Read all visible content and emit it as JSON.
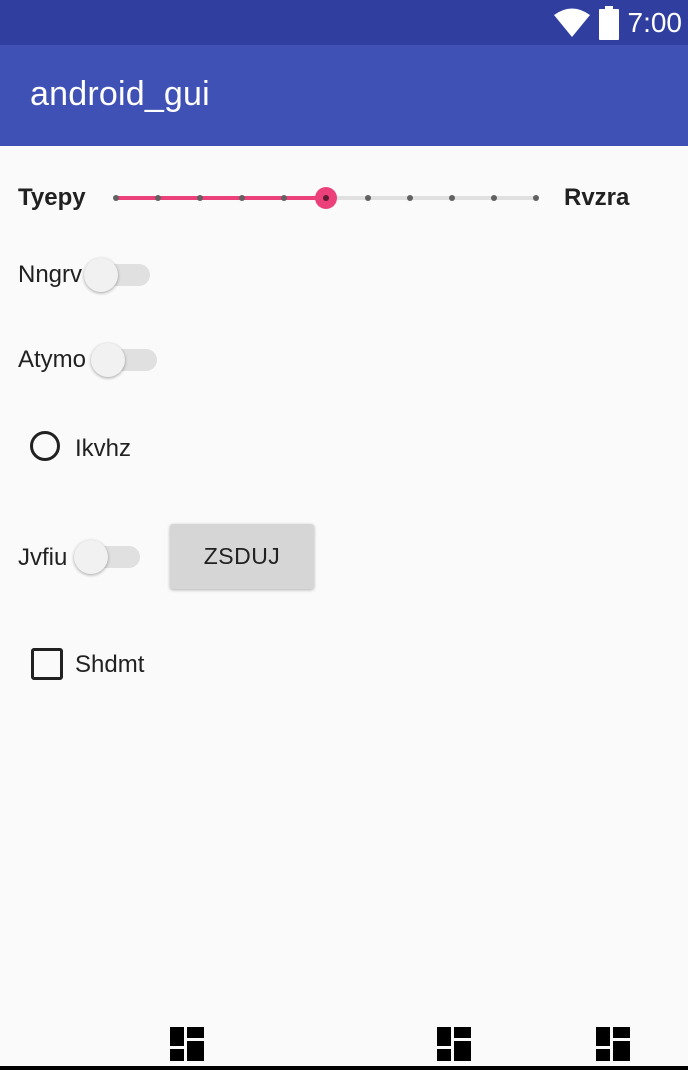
{
  "status_bar": {
    "time": "7:00",
    "icons": [
      "wifi-icon",
      "battery-icon"
    ]
  },
  "app_bar": {
    "title": "android_gui"
  },
  "seekbar_row": {
    "left_label": "Tyepy",
    "right_label": "Rvzra",
    "ticks": 11,
    "value": 5,
    "max": 10,
    "accent_color": "#ec407a"
  },
  "switches": [
    {
      "label": "Nngrv",
      "checked": false
    },
    {
      "label": "Atymo",
      "checked": false
    },
    {
      "label": "Jvfiu",
      "checked": false
    }
  ],
  "radio": {
    "label": "Ikvhz",
    "checked": false
  },
  "button": {
    "label": "ZSDUJ"
  },
  "checkbox": {
    "label": "Shdmt",
    "checked": false
  },
  "bottom_bar": {
    "icons": [
      "dashboard-icon",
      "dashboard-icon",
      "dashboard-icon"
    ]
  },
  "colors": {
    "status_bar": "#303f9f",
    "app_bar": "#3f51b5",
    "background": "#fafafa"
  }
}
